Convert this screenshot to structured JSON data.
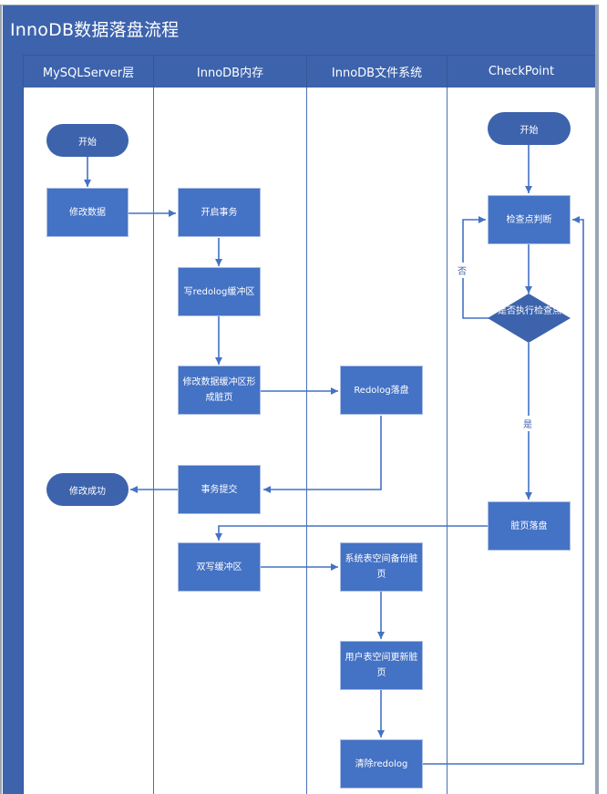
{
  "title": "InnoDB数据落盘流程",
  "lanes": [
    {
      "name": "MySQLServer层"
    },
    {
      "name": "InnoDB内存"
    },
    {
      "name": "InnoDB文件系统"
    },
    {
      "name": "CheckPoint"
    }
  ],
  "nodes": {
    "start_server": "开始",
    "modify_data": "修改数据",
    "modify_success": "修改成功",
    "begin_tx": "开启事务",
    "write_redo_buffer": "写redolog缓冲区",
    "modify_buffer_dirty": "修改数据缓冲区形成脏页",
    "tx_commit": "事务提交",
    "doublewrite_buffer": "双写缓冲区",
    "redolog_flush": "Redolog落盘",
    "sys_tablespace_backup": "系统表空间备份脏页",
    "user_tablespace_update": "用户表空间更新脏页",
    "clear_redolog": "清除redolog",
    "start_checkpoint": "开始",
    "checkpoint_judge": "检查点判断",
    "exec_checkpoint": "是否执行检查点",
    "dirty_page_flush": "脏页落盘"
  },
  "edge_labels": {
    "no": "否",
    "yes": "是"
  },
  "colors": {
    "header": "#3d63ad",
    "process": "#4472c4",
    "terminal": "#3d63ad",
    "line": "#4472c4"
  }
}
